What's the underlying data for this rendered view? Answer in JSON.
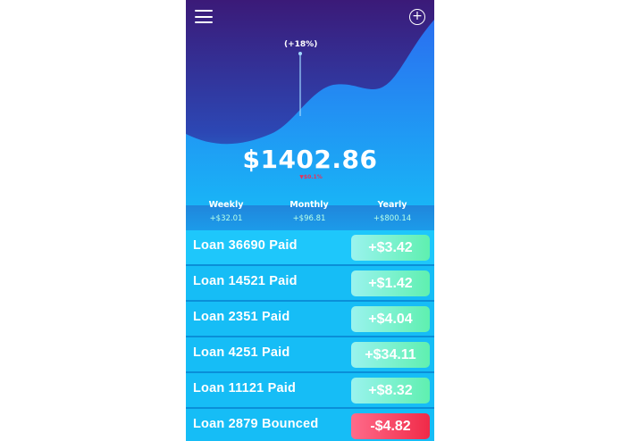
{
  "app": {
    "change_label": "(+18%)",
    "balance": "$1402.86",
    "balance_sub": "▼$0.1%",
    "colors": {
      "gradient_top": "#3b1a78",
      "gradient_bottom": "#16c3f8",
      "positive": "#5ff0b0",
      "negative": "#f02a48"
    },
    "icons": [
      "hamburger-menu-icon",
      "add-circle-icon"
    ]
  },
  "periods": [
    {
      "label": "Weekly",
      "value": "+$32.01"
    },
    {
      "label": "Monthly",
      "value": "+$96.81"
    },
    {
      "label": "Yearly",
      "value": "+$800.14"
    }
  ],
  "transactions": [
    {
      "label": "Loan 36690 Paid",
      "amount": "+$3.42"
    },
    {
      "label": "Loan 14521 Paid",
      "amount": "+$1.42"
    },
    {
      "label": "Loan 2351 Paid",
      "amount": "+$4.04"
    },
    {
      "label": "Loan 4251 Paid",
      "amount": "+$34.11"
    },
    {
      "label": "Loan 11121 Paid",
      "amount": "+$8.32"
    },
    {
      "label": "Loan 2879 Bounced",
      "amount": "-$4.82"
    }
  ]
}
